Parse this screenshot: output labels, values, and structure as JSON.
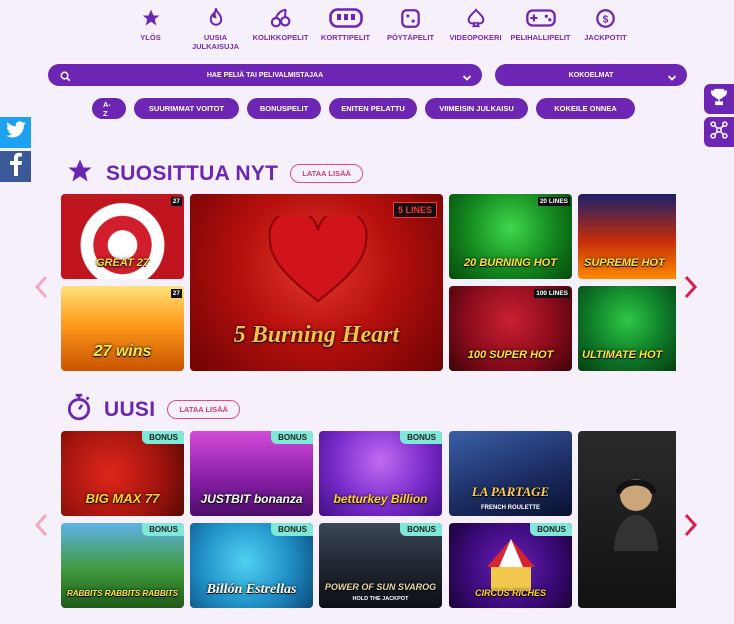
{
  "nav": {
    "items": [
      {
        "label": "YLÖS",
        "icon": "star-icon"
      },
      {
        "label": "UUSIA JULKAISUJA",
        "icon": "flame-icon"
      },
      {
        "label": "KOLIKKOPELIT",
        "icon": "cherries-icon"
      },
      {
        "label": "KORTTIPELIT",
        "icon": "card-table-icon"
      },
      {
        "label": "PÖYTÄPELIT",
        "icon": "dice-icon"
      },
      {
        "label": "VIDEOPOKERI",
        "icon": "spade-icon"
      },
      {
        "label": "PELIHALLIPELIT",
        "icon": "gamepad-icon"
      },
      {
        "label": "JACKPOTIT",
        "icon": "dollar-coin-icon"
      }
    ]
  },
  "search": {
    "placeholder": "HAE PELIÄ TAI PELIVALMISTAJAA"
  },
  "collections": {
    "label": "KOKOELMAT"
  },
  "filters": [
    "A-Z",
    "SUURIMMAT VOITOT",
    "BONUSPELIT",
    "ENITEN PELATTU",
    "VIIMEISIN JULKAISU",
    "KOKEILE ONNEA"
  ],
  "popular": {
    "title": "SUOSITTUA NYT",
    "load_more": "LATAA LISÄÄ",
    "games": [
      {
        "name": "27 wins",
        "lines": "27"
      },
      {
        "name": "GREAT 27",
        "lines": "27"
      },
      {
        "name": "5 Burning Heart",
        "lines": "5 LINES"
      },
      {
        "name": "20 BURNING HOT",
        "lines": "20 LINES"
      },
      {
        "name": "100 SUPER HOT",
        "lines": "100 LINES"
      },
      {
        "name": "SUPREME HOT",
        "lines": ""
      },
      {
        "name": "ULTIMATE HOT",
        "lines": ""
      }
    ]
  },
  "new": {
    "title": "UUSI",
    "load_more": "LATAA LISÄÄ",
    "badge": "BONUS",
    "games": [
      {
        "name": "BIG MAX 77"
      },
      {
        "name": "JUSTBIT bonanza"
      },
      {
        "name": "betturkey Billion"
      },
      {
        "name": "LA PARTAGE",
        "sub": "FRENCH ROULETTE"
      },
      {
        "name": "RABBITS RABBITS RABBITS"
      },
      {
        "name": "Billón Estrellas"
      },
      {
        "name": "POWER OF SUN SVAROG",
        "sub": "HOLD THE JACKPOT"
      },
      {
        "name": "CIRCUS RICHES"
      }
    ]
  },
  "colors": {
    "brand": "#6d26b4",
    "accent": "#d43b74",
    "badge": "#7fe8d8"
  }
}
